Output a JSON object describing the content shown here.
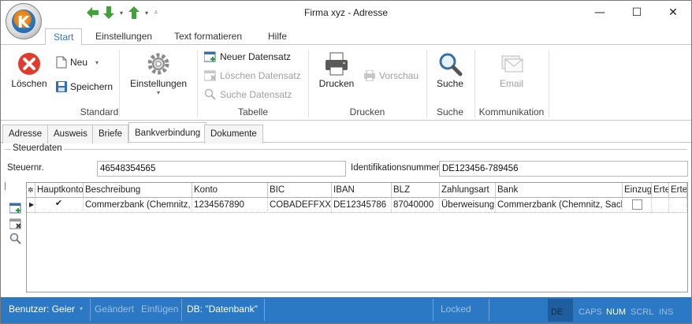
{
  "window": {
    "title": "Firma xyz - Adresse",
    "minimize": "—",
    "maximize": "☐",
    "close": "✕"
  },
  "ribbon_tabs": [
    "Start",
    "Einstellungen",
    "Text formatieren",
    "Hilfe"
  ],
  "ribbon": {
    "loeschen": "Löschen",
    "neu": "Neu",
    "speichern": "Speichern",
    "einstellungen": "Einstellungen",
    "group_standard": "Standard",
    "neuer_datensatz": "Neuer Datensatz",
    "loeschen_datensatz": "Löschen Datensatz",
    "suche_datensatz": "Suche Datensatz",
    "group_tabelle": "Tabelle",
    "drucken": "Drucken",
    "vorschau": "Vorschau",
    "group_drucken": "Drucken",
    "suche": "Suche",
    "group_suche": "Suche",
    "email": "Email",
    "group_kommunikation": "Kommunikation"
  },
  "content_tabs": [
    "Adresse",
    "Ausweis",
    "Briefe",
    "Bankverbindung",
    "Dokumente"
  ],
  "steuerdaten": {
    "legend": "Steuerdaten",
    "steuernr_label": "Steuernr.",
    "steuernr_value": "46548354565",
    "idnr_label": "Identifikationsnummer",
    "idnr_value": "DE123456-789456"
  },
  "grid": {
    "columns": [
      "Hauptkonto",
      "Beschreibung",
      "Konto",
      "BIC",
      "IBAN",
      "BLZ",
      "Zahlungsart",
      "Bank",
      "Einzug",
      "Erte",
      "Erte"
    ],
    "rows": [
      {
        "hauptkonto": "✔",
        "beschreibung": "Commerzbank (Chemnitz, Sa",
        "konto": "1234567890",
        "bic": "COBADEFFXXX",
        "iban": "DE12345786",
        "blz": "87040000",
        "zahlungsart": "Überweisung",
        "bank": "Commerzbank (Chemnitz, Sachs)",
        "einzug": ""
      }
    ]
  },
  "statusbar": {
    "benutzer": "Benutzer: Geier",
    "geaendert": "Geändert",
    "einfuegen": "Einfügen",
    "db": "DB: \"Datenbank\"",
    "locked": "Locked",
    "lang": "DE",
    "caps": "CAPS",
    "num": "NUM",
    "scrl": "SCRL",
    "ins": "INS"
  },
  "colors": {
    "accent": "#2b78c5",
    "statusbar": "#2b78c5"
  }
}
